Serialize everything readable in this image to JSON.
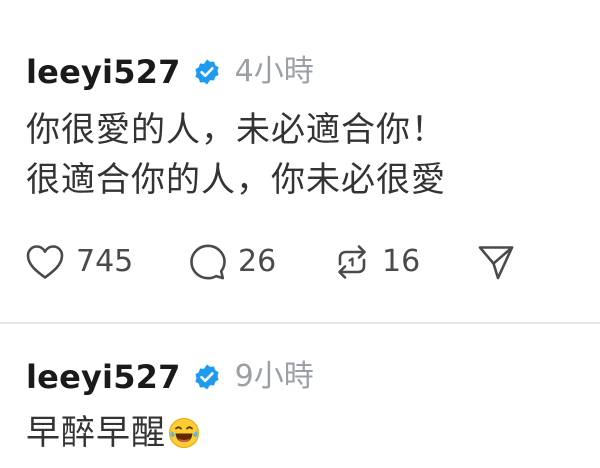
{
  "colors": {
    "verified_badge": "#1d9bf0",
    "username": "#1a1a1a",
    "timestamp": "#9aa0a6",
    "body_text": "#333333",
    "icon_stroke": "#4a4a4a",
    "divider": "#e5e7eb"
  },
  "posts": [
    {
      "username": "leeyi527",
      "verified_icon": "verified-check-badge",
      "time": "4小時",
      "text_lines": [
        "你很愛的人，未必適合你！",
        "很適合你的人，你未必很愛"
      ],
      "actions": {
        "like": {
          "icon": "heart-icon",
          "count": "745"
        },
        "reply": {
          "icon": "comment-bubble-icon",
          "count": "26"
        },
        "repost": {
          "icon": "repost-arrows-icon",
          "count": "16"
        },
        "share": {
          "icon": "send-icon"
        }
      }
    },
    {
      "username": "leeyi527",
      "verified_icon": "verified-check-badge",
      "time": "9小時",
      "text_lines": [
        "早醉早醒"
      ],
      "trailing_emoji": "laughing-tears-emoji"
    }
  ]
}
